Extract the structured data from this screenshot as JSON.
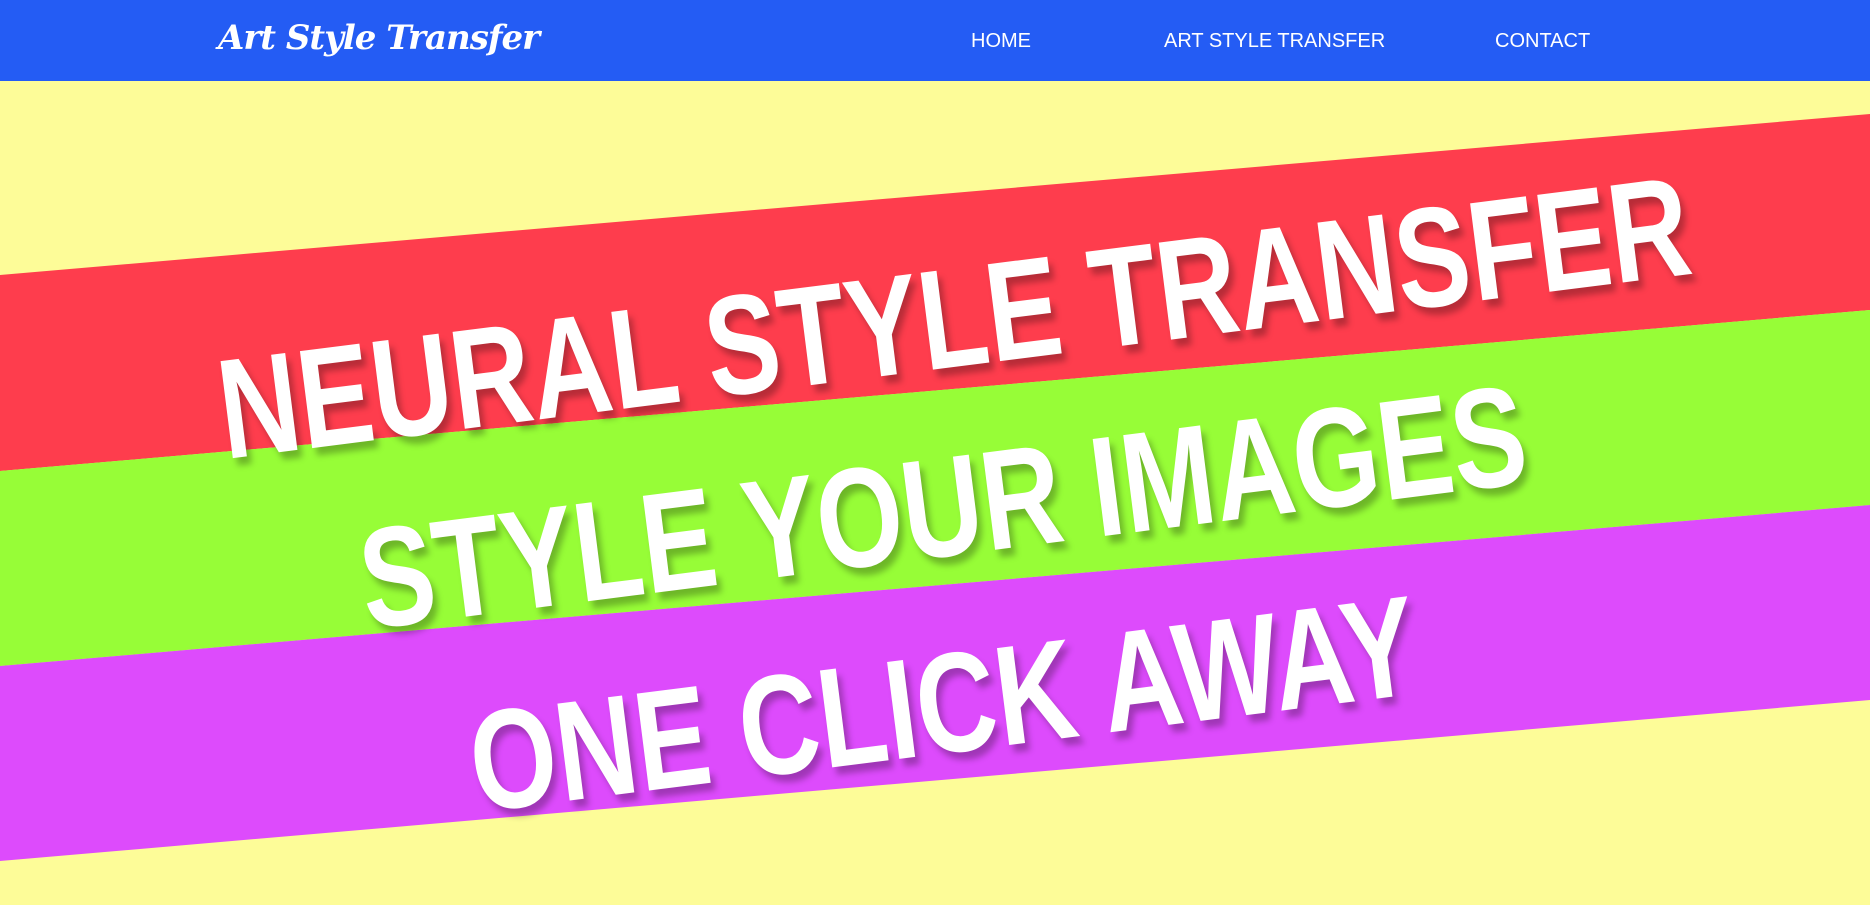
{
  "nav": {
    "brand": "Art Style Transfer",
    "links": [
      "HOME",
      "ART STYLE TRANSFER",
      "CONTACT"
    ]
  },
  "hero": {
    "lines": [
      "NEURAL STYLE TRANSFER",
      "STYLE YOUR IMAGES",
      "ONE CLICK AWAY"
    ]
  },
  "colors": {
    "nav_background": "#245cf4",
    "page_background": "#fdfc98",
    "stripe_red": "#fe3d4d",
    "stripe_green": "#97fd37",
    "stripe_purple": "#dd4bfc",
    "text": "#ffffff"
  }
}
